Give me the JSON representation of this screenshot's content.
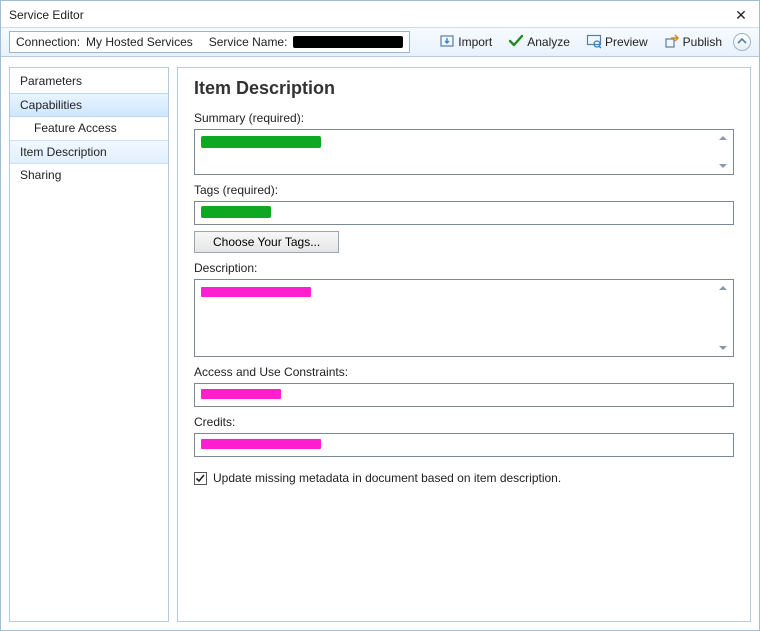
{
  "title": "Service Editor",
  "toolbar": {
    "connection_label": "Connection:",
    "connection_value": "My Hosted Services",
    "service_name_label": "Service Name:",
    "import": "Import",
    "analyze": "Analyze",
    "preview": "Preview",
    "publish": "Publish"
  },
  "sidebar": {
    "items": [
      {
        "label": "Parameters"
      },
      {
        "label": "Capabilities"
      },
      {
        "label": "Feature Access"
      },
      {
        "label": "Item Description"
      },
      {
        "label": "Sharing"
      }
    ]
  },
  "panel": {
    "heading": "Item Description",
    "summary_label": "Summary (required):",
    "tags_label": "Tags (required):",
    "choose_tags": "Choose Your Tags...",
    "description_label": "Description:",
    "constraints_label": "Access and Use Constraints:",
    "credits_label": "Credits:",
    "checkbox_label": "Update missing metadata in document based on item description."
  }
}
